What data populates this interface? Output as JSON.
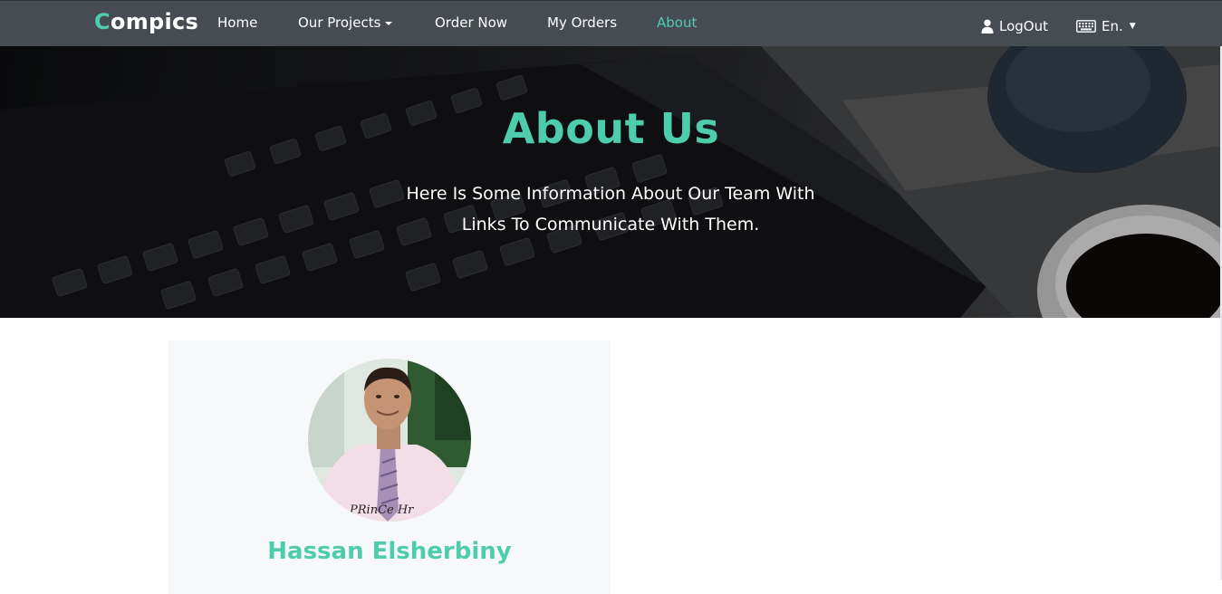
{
  "navbar": {
    "brand_first": "C",
    "brand_rest": "ompics",
    "items": [
      {
        "label": "Home"
      },
      {
        "label": "Our Projects"
      },
      {
        "label": "Order Now"
      },
      {
        "label": "My Orders"
      },
      {
        "label": "About"
      }
    ],
    "logout_label": "LogOut",
    "language_label": "En."
  },
  "hero": {
    "title": "About Us",
    "subtitle_line1": "Here Is Some Information About Our Team With",
    "subtitle_line2": "Links To Communicate With Them."
  },
  "team": {
    "members": [
      {
        "name": "Hassan Elsherbiny",
        "signature": "PRinCe Hr"
      }
    ]
  },
  "colors": {
    "accent": "#4ecdac",
    "navbar_bg": "#474c53",
    "card_bg": "#f7f8fa"
  },
  "icons": {
    "dropdown": "caret-down-icon",
    "logout": "user-icon",
    "language": "keyboard-icon"
  }
}
